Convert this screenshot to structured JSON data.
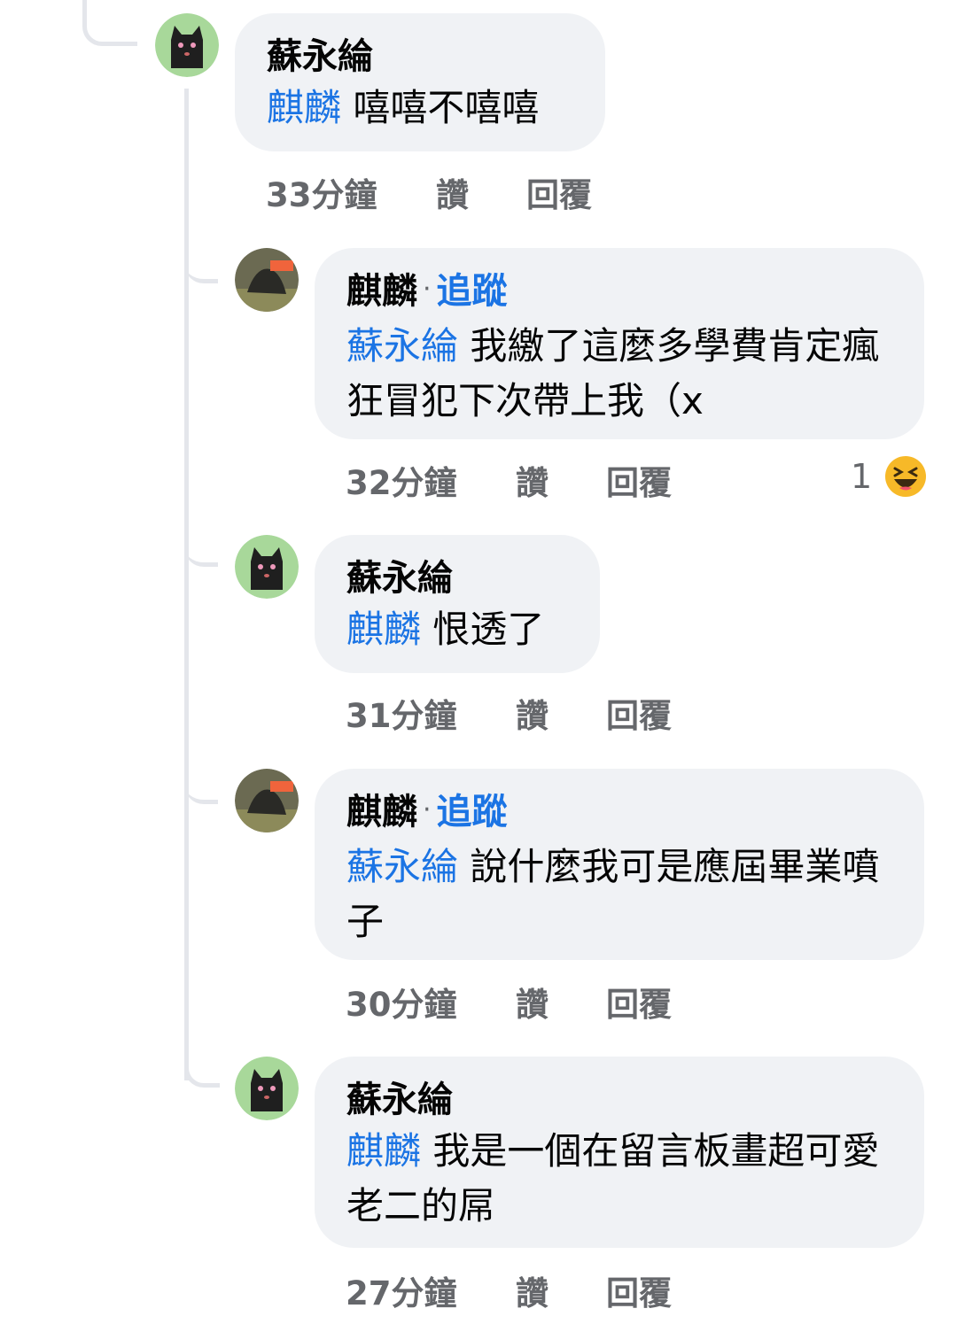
{
  "colors": {
    "link": "#1b74e4",
    "bubble": "#f0f2f5",
    "meta": "#65676b",
    "thread_line": "#e4e6eb"
  },
  "comments": [
    {
      "author": "蘇永綸",
      "follow_label": "",
      "mention": "麒麟",
      "text": "嘻嘻不嘻嘻",
      "time": "33分鐘",
      "like_label": "讚",
      "reply_label": "回覆",
      "avatar": "black-cat-avatar-icon"
    },
    {
      "author": "麒麟",
      "follow_label": "追蹤",
      "mention": "蘇永綸",
      "text": "我繳了這麼多學費肯定瘋狂冒犯下次帶上我（x",
      "time": "32分鐘",
      "like_label": "讚",
      "reply_label": "回覆",
      "avatar": "photo-avatar-icon",
      "reaction": {
        "count": "1",
        "icon": "haha-reaction-icon"
      }
    },
    {
      "author": "蘇永綸",
      "follow_label": "",
      "mention": "麒麟",
      "text": "恨透了",
      "time": "31分鐘",
      "like_label": "讚",
      "reply_label": "回覆",
      "avatar": "black-cat-avatar-icon"
    },
    {
      "author": "麒麟",
      "follow_label": "追蹤",
      "mention": "蘇永綸",
      "text": "說什麼我可是應屆畢業噴子",
      "time": "30分鐘",
      "like_label": "讚",
      "reply_label": "回覆",
      "avatar": "photo-avatar-icon"
    },
    {
      "author": "蘇永綸",
      "follow_label": "",
      "mention": "麒麟",
      "text": "我是一個在留言板畫超可愛老二的屌",
      "time": "27分鐘",
      "like_label": "讚",
      "reply_label": "回覆",
      "avatar": "black-cat-avatar-icon"
    }
  ]
}
